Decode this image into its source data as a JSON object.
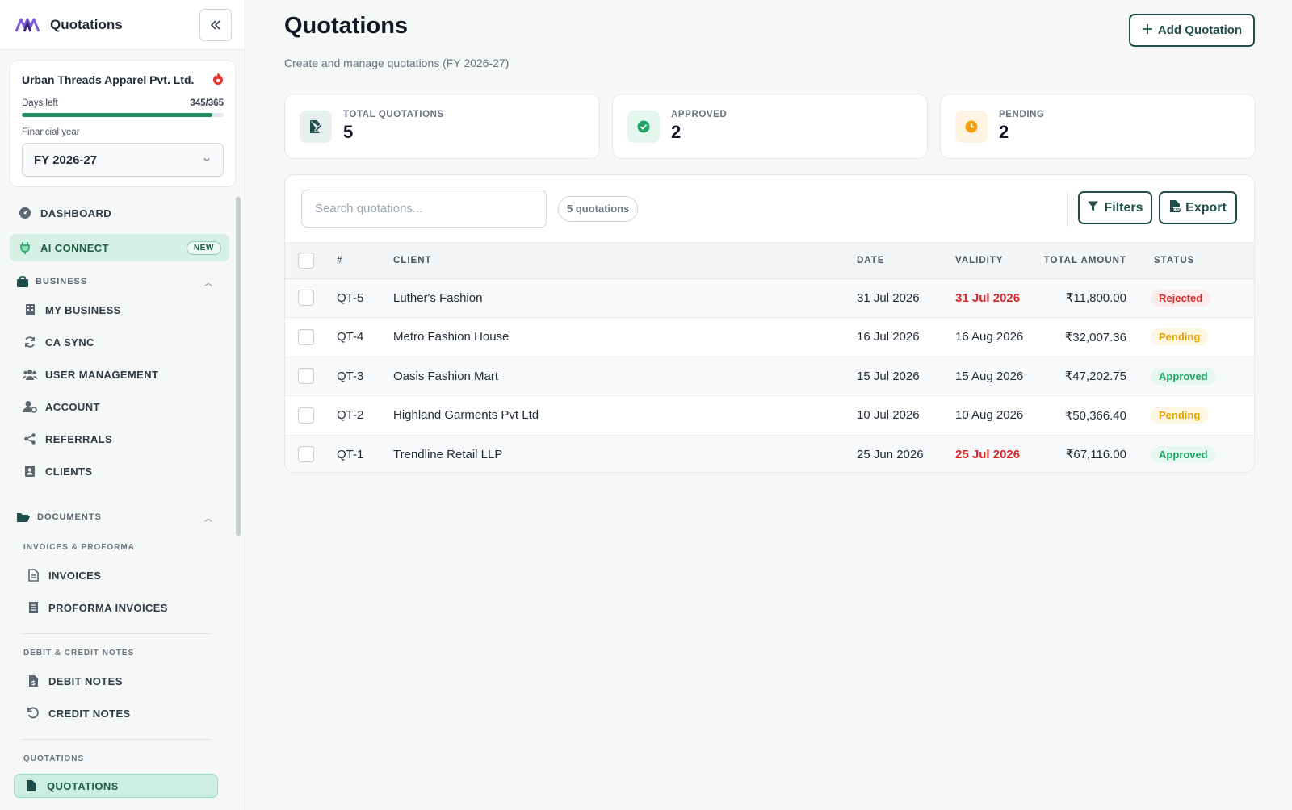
{
  "sidebar": {
    "title": "Quotations",
    "company": {
      "name": "Urban Threads Apparel Pvt. Ltd.",
      "days_label": "Days left",
      "days_value": "345/365",
      "days_fraction": 0.945,
      "fy_label": "Financial year",
      "fy_value": "FY 2026-27"
    },
    "nav": {
      "dashboard": "DASHBOARD",
      "ai_connect": "AI CONNECT",
      "new_badge": "NEW",
      "business_section": "BUSINESS",
      "my_business": "MY BUSINESS",
      "ca_sync": "CA SYNC",
      "user_management": "USER MANAGEMENT",
      "account": "ACCOUNT",
      "referrals": "REFERRALS",
      "clients": "CLIENTS",
      "documents_section": "DOCUMENTS",
      "invoices_group": "INVOICES & PROFORMA",
      "invoices": "INVOICES",
      "proforma_invoices": "PROFORMA INVOICES",
      "notes_group": "DEBIT & CREDIT NOTES",
      "debit_notes": "DEBIT NOTES",
      "credit_notes": "CREDIT NOTES",
      "quotations_group": "QUOTATIONS",
      "quotations": "QUOTATIONS"
    }
  },
  "header": {
    "title": "Quotations",
    "subtitle": "Create and manage quotations (FY 2026-27)",
    "add_button": "Add Quotation"
  },
  "stats": [
    {
      "label": "TOTAL QUOTATIONS",
      "value": "5",
      "icon": "edit-document-icon",
      "color": "#1e4d4a"
    },
    {
      "label": "APPROVED",
      "value": "2",
      "icon": "check-circle-icon",
      "color": "#1ea565"
    },
    {
      "label": "PENDING",
      "value": "2",
      "icon": "clock-icon",
      "color": "#f59e0b"
    }
  ],
  "toolbar": {
    "search_placeholder": "Search quotations...",
    "count": "5 quotations",
    "filters": "Filters",
    "export": "Export"
  },
  "table": {
    "columns": {
      "num": "#",
      "client": "CLIENT",
      "date": "DATE",
      "validity": "VALIDITY",
      "total": "TOTAL AMOUNT",
      "status": "STATUS"
    },
    "rows": [
      {
        "num": "QT-5",
        "client": "Luther's Fashion",
        "date": "31 Jul 2026",
        "validity": "31 Jul 2026",
        "total": "₹11,800.00",
        "status": "Rejected"
      },
      {
        "num": "QT-4",
        "client": "Metro Fashion House",
        "date": "16 Jul 2026",
        "validity": "16 Aug 2026",
        "total": "₹32,007.36",
        "status": "Pending"
      },
      {
        "num": "QT-3",
        "client": "Oasis Fashion Mart",
        "date": "15 Jul 2026",
        "validity": "15 Aug 2026",
        "total": "₹47,202.75",
        "status": "Approved"
      },
      {
        "num": "QT-2",
        "client": "Highland Garments Pvt Ltd",
        "date": "10 Jul 2026",
        "validity": "10 Aug 2026",
        "total": "₹50,366.40",
        "status": "Pending"
      },
      {
        "num": "QT-1",
        "client": "Trendline Retail LLP",
        "date": "25 Jun 2026",
        "validity": "25 Jul 2026",
        "total": "₹67,116.00",
        "status": "Approved"
      }
    ]
  },
  "colors": {
    "accent": "#1e4d4a",
    "progress": "#1e8f5a",
    "expired": "#dc2626"
  }
}
